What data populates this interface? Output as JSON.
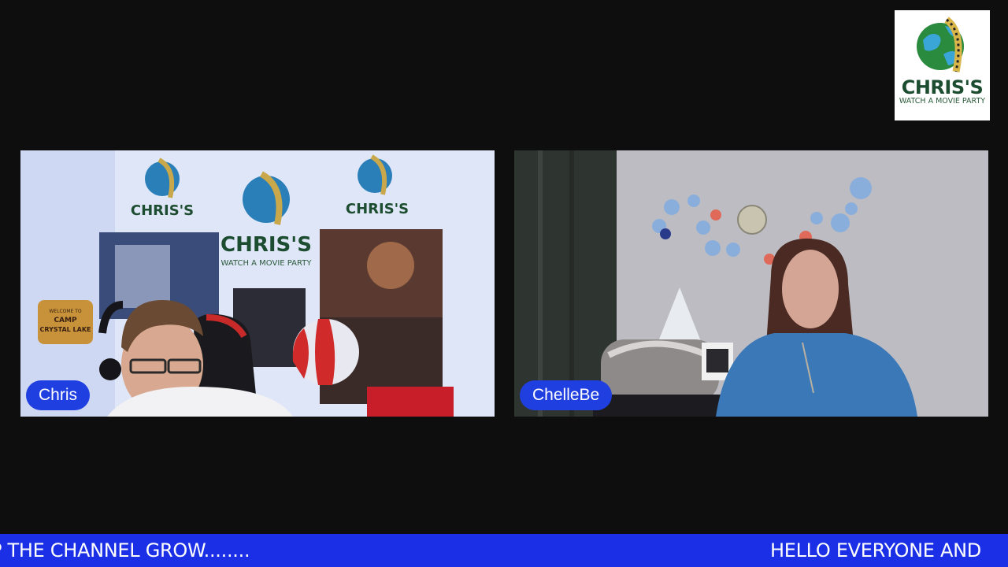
{
  "logo": {
    "title": "CHRIS'S",
    "subtitle": "WATCH A MOVIE PARTY"
  },
  "participants": [
    {
      "name": "Chris"
    },
    {
      "name": "ChelleBe"
    }
  ],
  "backdrop": {
    "logo_title": "CHRIS'S",
    "logo_subtitle": "WATCH A MOVIE PARTY",
    "sign_line1": "WELCOME TO",
    "sign_line2": "CAMP",
    "sign_line3": "CRYSTAL LAKE"
  },
  "ticker": {
    "left_text": "P THE CHANNEL GROW........",
    "right_text": "HELLO EVERYONE AND"
  },
  "colors": {
    "background": "#0e0e0e",
    "accent": "#1f3fe0",
    "ticker": "#1a2fe6",
    "brand_green": "#1d4d30"
  }
}
